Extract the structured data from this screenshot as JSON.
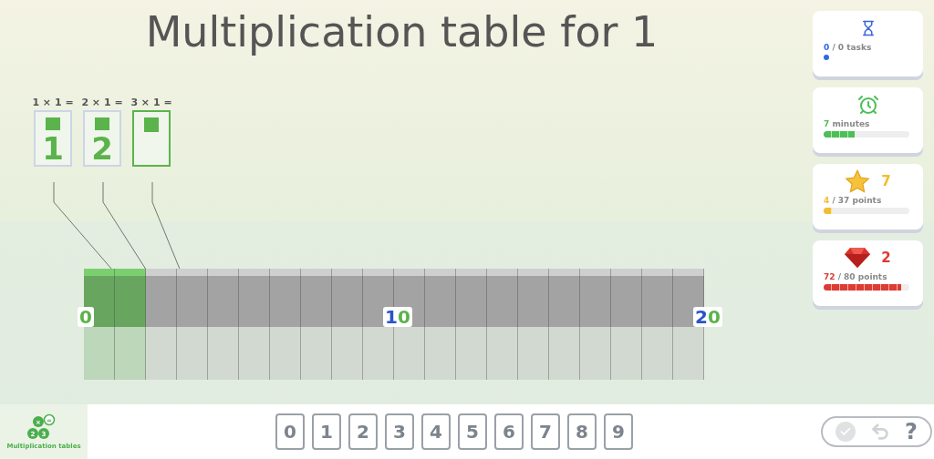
{
  "title": "Multiplication table for 1",
  "answers": [
    {
      "expression": "1 × 1 =",
      "answer": "1",
      "selected": false
    },
    {
      "expression": "2 × 1 =",
      "answer": "2",
      "selected": false
    },
    {
      "expression": "3 × 1 =",
      "selected": true
    }
  ],
  "number_line": {
    "blocks": [
      {
        "filled": true
      },
      {
        "filled": true
      },
      {
        "filled": false
      },
      {
        "filled": false
      },
      {
        "filled": false
      },
      {
        "filled": false
      },
      {
        "filled": false
      },
      {
        "filled": false
      },
      {
        "filled": false
      },
      {
        "filled": false
      },
      {
        "filled": false
      },
      {
        "filled": false
      },
      {
        "filled": false
      },
      {
        "filled": false
      },
      {
        "filled": false
      },
      {
        "filled": false
      },
      {
        "filled": false
      },
      {
        "filled": false
      },
      {
        "filled": false
      },
      {
        "filled": false
      }
    ],
    "labels": [
      {
        "ones": "0"
      },
      {
        "tens": "1",
        "ones": "0"
      },
      {
        "tens": "2",
        "ones": "0"
      }
    ]
  },
  "stats": [
    {
      "kind": "tasks",
      "value_text": "0",
      "text": "/ 0 tasks",
      "color": "#2f6ae6"
    },
    {
      "kind": "time",
      "value_text": "7",
      "text": "minutes",
      "level": 0.36,
      "color": "#4cbf56"
    },
    {
      "kind": "stars",
      "badge": "7",
      "value_text": "4",
      "text": "/ 37 points",
      "level": 0.1,
      "color": "#f2bd2e"
    },
    {
      "kind": "gems",
      "badge": "2",
      "value_text": "72",
      "text": "/ 80 points",
      "level": 0.9,
      "color": "#dd3b33"
    }
  ],
  "logo": {
    "symbols": [
      "×",
      "=",
      "2",
      "3"
    ],
    "label": "Multiplication tables"
  },
  "keypad": [
    "0",
    "1",
    "2",
    "3",
    "4",
    "5",
    "6",
    "7",
    "8",
    "9"
  ],
  "controls": {
    "check_disabled": true,
    "undo_disabled": true,
    "help": "?"
  }
}
